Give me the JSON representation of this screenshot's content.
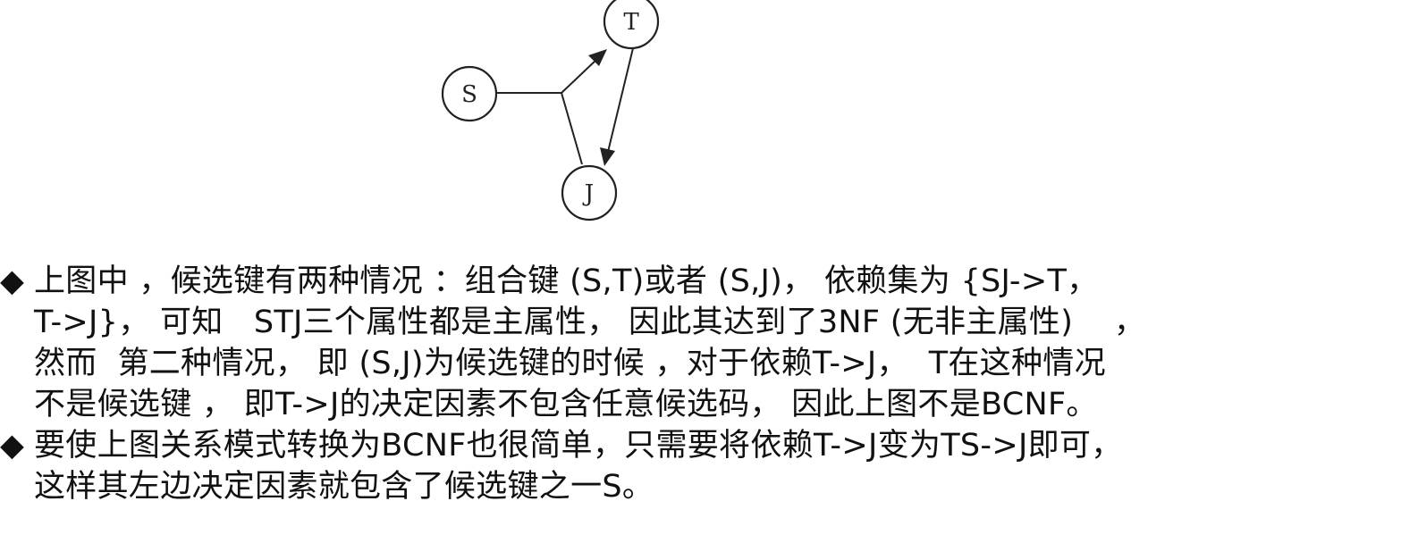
{
  "diagram": {
    "nodes": [
      {
        "id": "S",
        "label": "S"
      },
      {
        "id": "T",
        "label": "T"
      },
      {
        "id": "J",
        "label": "J"
      }
    ],
    "edges": [
      {
        "from": "S",
        "to": "T"
      },
      {
        "from": "T",
        "to": "J"
      },
      {
        "from": "S",
        "to": "J"
      }
    ]
  },
  "content": {
    "bullet_symbol": "◆",
    "bullets": [
      {
        "lines": [
          "上图中 ，候选键有两种情况 ：组合键 (S,T)或者 (S,J)， 依赖集为 {SJ->T，",
          "T->J}， 可知   STJ三个属性都是主属性， 因此其达到了3NF (无非主属性)    ，",
          "然而  第二种情况， 即 (S,J)为候选键的时候 ，对于依赖T->J，  T在这种情况",
          "不是候选键 ， 即T->J的决定因素不包含任意候选码， 因此上图不是BCNF。"
        ]
      },
      {
        "lines": [
          "要使上图关系模式转换为BCNF也很简单，只需要将依赖T->J变为TS->J即可，",
          "这样其左边决定因素就包含了候选键之一S。"
        ]
      }
    ]
  }
}
